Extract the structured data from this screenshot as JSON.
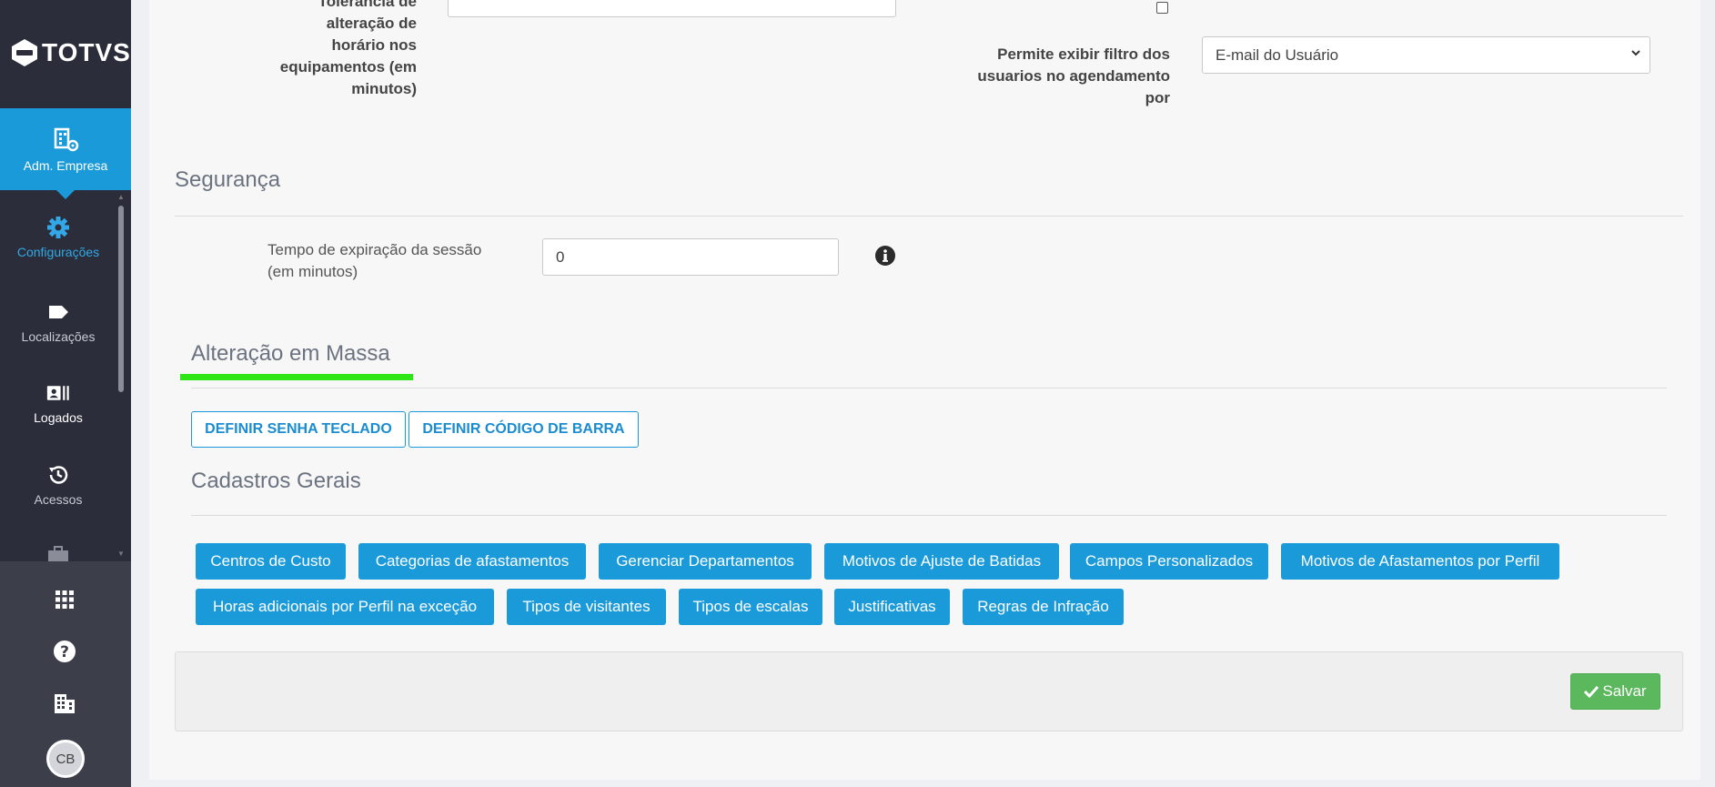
{
  "sidebar": {
    "logo": "TOTVS",
    "active_item": {
      "label": "Adm. Empresa",
      "icon": "company-admin-icon"
    },
    "items": [
      {
        "label": "Configurações",
        "icon": "gear-icon"
      },
      {
        "label": "Localizações",
        "icon": "tag-icon"
      },
      {
        "label": "Logados",
        "icon": "id-card-icon"
      },
      {
        "label": "Acessos",
        "icon": "history-icon"
      }
    ],
    "bottom_icons": [
      "apps-grid-icon",
      "help-icon",
      "building-icon"
    ],
    "avatar_initials": "CB"
  },
  "form": {
    "tolerance_label_l1": "Tolerância de",
    "tolerance_label_l2": "alteração de",
    "tolerance_label_l3": "horário nos",
    "tolerance_label_l4": "equipamentos (em",
    "tolerance_label_l5": "minutos)",
    "filter_label_l1": "Permite exibir filtro dos",
    "filter_label_l2": "usuarios no agendamento",
    "filter_label_l3": "por",
    "filter_select_value": "E-mail do Usuário"
  },
  "seguranca": {
    "title": "Segurança",
    "session_label_l1": "Tempo de expiração da sessão",
    "session_label_l2": "(em minutos)",
    "session_value": "0",
    "info_icon": "info-icon"
  },
  "massa": {
    "title": "Alteração em Massa",
    "underline_color": "#2ee616",
    "buttons": [
      "DEFINIR SENHA TECLADO",
      "DEFINIR CÓDIGO DE BARRA"
    ]
  },
  "cadastros": {
    "title": "Cadastros Gerais",
    "row1": [
      "Centros de Custo",
      "Categorias de afastamentos",
      "Gerenciar Departamentos",
      "Motivos de Ajuste de Batidas",
      "Campos Personalizados",
      "Motivos de Afastamentos por Perfil"
    ],
    "row2": [
      "Horas adicionais por Perfil na exceção",
      "Tipos de visitantes",
      "Tipos de escalas",
      "Justificativas",
      "Regras de Infração"
    ]
  },
  "footer": {
    "save_label": "Salvar",
    "save_color": "#5cb85c"
  },
  "colors": {
    "accent": "#1a9ad9",
    "sidebar": "#2b2d3a"
  }
}
